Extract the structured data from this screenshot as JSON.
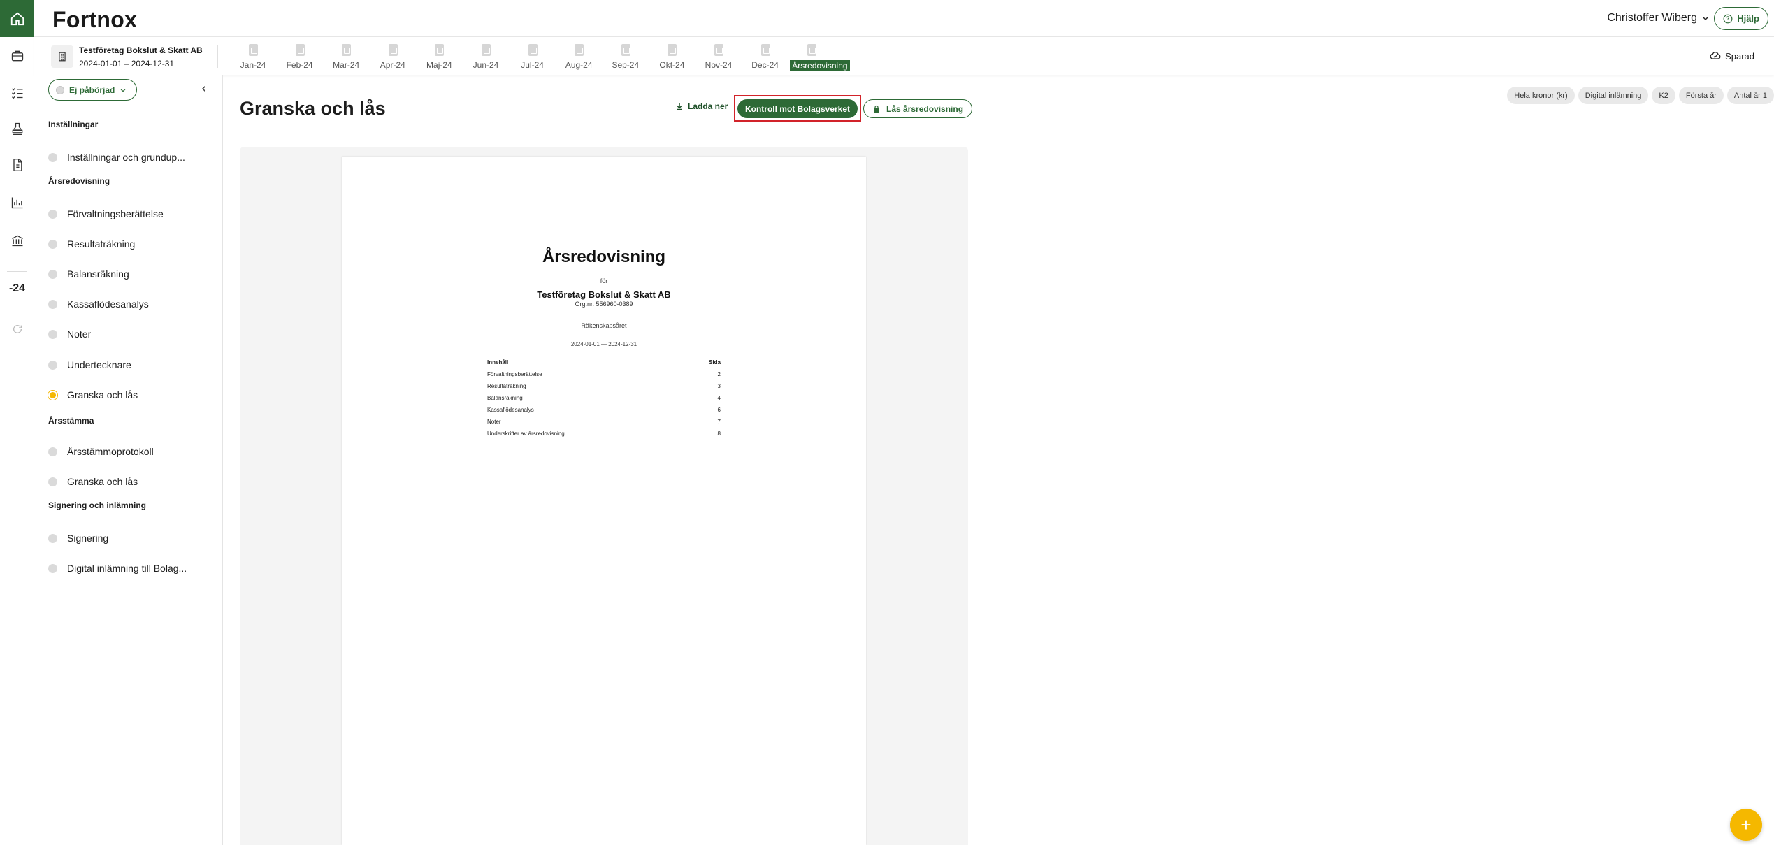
{
  "app": {
    "logo": "Fortnox"
  },
  "header": {
    "user_name": "Christoffer Wiberg",
    "help_label": "Hjälp"
  },
  "rail": {
    "year_label": "-24"
  },
  "company": {
    "name": "Testföretag Bokslut & Skatt AB",
    "period": "2024-01-01 – 2024-12-31"
  },
  "periods": [
    "Jan-24",
    "Feb-24",
    "Mar-24",
    "Apr-24",
    "Maj-24",
    "Jun-24",
    "Jul-24",
    "Aug-24",
    "Sep-24",
    "Okt-24",
    "Nov-24",
    "Dec-24",
    "Årsredovisning"
  ],
  "active_period": "Årsredovisning",
  "save_status": "Sparad",
  "sidebar": {
    "status_label": "Ej påbörjad",
    "sections": [
      {
        "title": "Inställningar",
        "items": [
          {
            "label": "Inställningar och grundup..."
          }
        ]
      },
      {
        "title": "Årsredovisning",
        "items": [
          {
            "label": "Förvaltningsberättelse"
          },
          {
            "label": "Resultaträkning"
          },
          {
            "label": "Balansräkning"
          },
          {
            "label": "Kassaflödesanalys"
          },
          {
            "label": "Noter"
          },
          {
            "label": "Undertecknare"
          },
          {
            "label": "Granska och lås",
            "active": true
          }
        ]
      },
      {
        "title": "Årsstämma",
        "items": [
          {
            "label": "Årsstämmoprotokoll"
          },
          {
            "label": "Granska och lås"
          }
        ]
      },
      {
        "title": "Signering och inlämning",
        "items": [
          {
            "label": "Signering"
          },
          {
            "label": "Digital inlämning till Bolag..."
          }
        ]
      }
    ]
  },
  "main": {
    "title": "Granska och lås",
    "download_label": "Ladda ner",
    "check_label": "Kontroll mot Bolagsverket",
    "lock_label": "Lås årsredovisning",
    "tags": [
      "Hela kronor (kr)",
      "Digital inlämning",
      "K2",
      "Första år",
      "Antal år 1"
    ]
  },
  "document": {
    "title": "Årsredovisning",
    "for_label": "för",
    "company": "Testföretag Bokslut & Skatt AB",
    "org_nr": "Org.nr. 556960-0389",
    "fiscal_year_label": "Räkenskapsåret",
    "period": "2024-01-01 — 2024-12-31",
    "toc_headers": {
      "content": "Innehåll",
      "page": "Sida"
    },
    "toc": [
      {
        "label": "Förvaltningsberättelse",
        "page": "2"
      },
      {
        "label": "Resultaträkning",
        "page": "3"
      },
      {
        "label": "Balansräkning",
        "page": "4"
      },
      {
        "label": "Kassaflödesanalys",
        "page": "6"
      },
      {
        "label": "Noter",
        "page": "7"
      },
      {
        "label": "Underskrifter av årsredovisning",
        "page": "8"
      }
    ]
  },
  "fab_label": "+",
  "colors": {
    "brand_green": "#2d6a36",
    "accent_yellow": "#f5b800",
    "highlight_red": "#d2232a"
  }
}
